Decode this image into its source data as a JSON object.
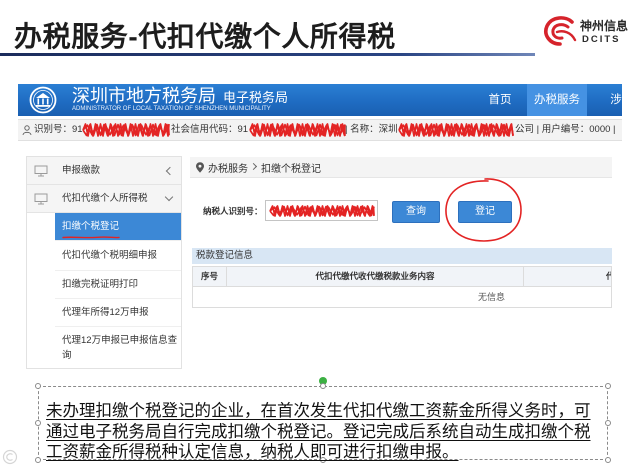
{
  "slide": {
    "title": "办税服务-代扣代缴个人所得税"
  },
  "logo": {
    "cn": "神州信息",
    "en": "DCITS",
    "icon": "dcits-swirl-logo"
  },
  "colors": {
    "header_blue": "#1f6cc2",
    "accent_blue": "#3c88d6",
    "annotation_red": "#e32424",
    "brand_red": "#d6232b",
    "title_rule_navy": "#1b2c5c",
    "handle_green": "#3cb043"
  },
  "site": {
    "emblem_icon": "tax-bureau-emblem",
    "title": "深圳市地方税务局",
    "subtitle": "电子税务局",
    "title_en": "ADMINISTRATOR OF LOCAL TAXATION OF SHENZHEN MUNICIPALITY",
    "nav": [
      {
        "label": "首页",
        "active": false
      },
      {
        "label": "办税服务",
        "active": true
      },
      {
        "label": "涉",
        "active": false
      }
    ],
    "infobar": {
      "icon": "user-icon",
      "id": "识别号：91",
      "credit_code": "社会信用代码：91",
      "name": "| 名称：深圳",
      "tail": "公司 | 用户编号：0000 |"
    },
    "sidebar": {
      "groups": [
        {
          "label": "申报缴款",
          "icon": "monitor-icon",
          "chevron": "chevron-left-icon",
          "expanded": false
        },
        {
          "label": "代扣代缴个人所得税",
          "icon": "monitor-icon",
          "chevron": "chevron-down-icon",
          "expanded": true
        }
      ],
      "items": [
        {
          "label": "扣缴个税登记",
          "selected": true
        },
        {
          "label": "代扣代缴个税明细申报",
          "selected": false
        },
        {
          "label": "扣缴完税证明打印",
          "selected": false
        },
        {
          "label": "代理年所得12万申报",
          "selected": false
        },
        {
          "label": "代理12万申报已申报信息查询",
          "selected": false
        }
      ]
    },
    "breadcrumb": {
      "icon": "location-pin-icon",
      "root": "办税服务",
      "separator_icon": "chevron-right-icon",
      "current": "扣缴个税登记"
    },
    "form": {
      "label": "纳税人识别号：",
      "query_button": "查询",
      "register_button": "登记"
    },
    "section": {
      "title": "税款登记信息"
    },
    "table": {
      "headers": [
        "序号",
        "代扣代缴代收代缴税款业务内容",
        "代"
      ],
      "empty_text": "无信息"
    }
  },
  "note": {
    "lines": [
      "未办理扣缴个税登记的企业，在首次发生代扣代缴工资薪金所得义务时，可",
      "通过电子税务局自行完成扣缴个税登记。登记完成后系统自动生成扣缴个税",
      "工资薪金所得税种认定信息，纳税人即可进行扣缴申报。"
    ]
  }
}
